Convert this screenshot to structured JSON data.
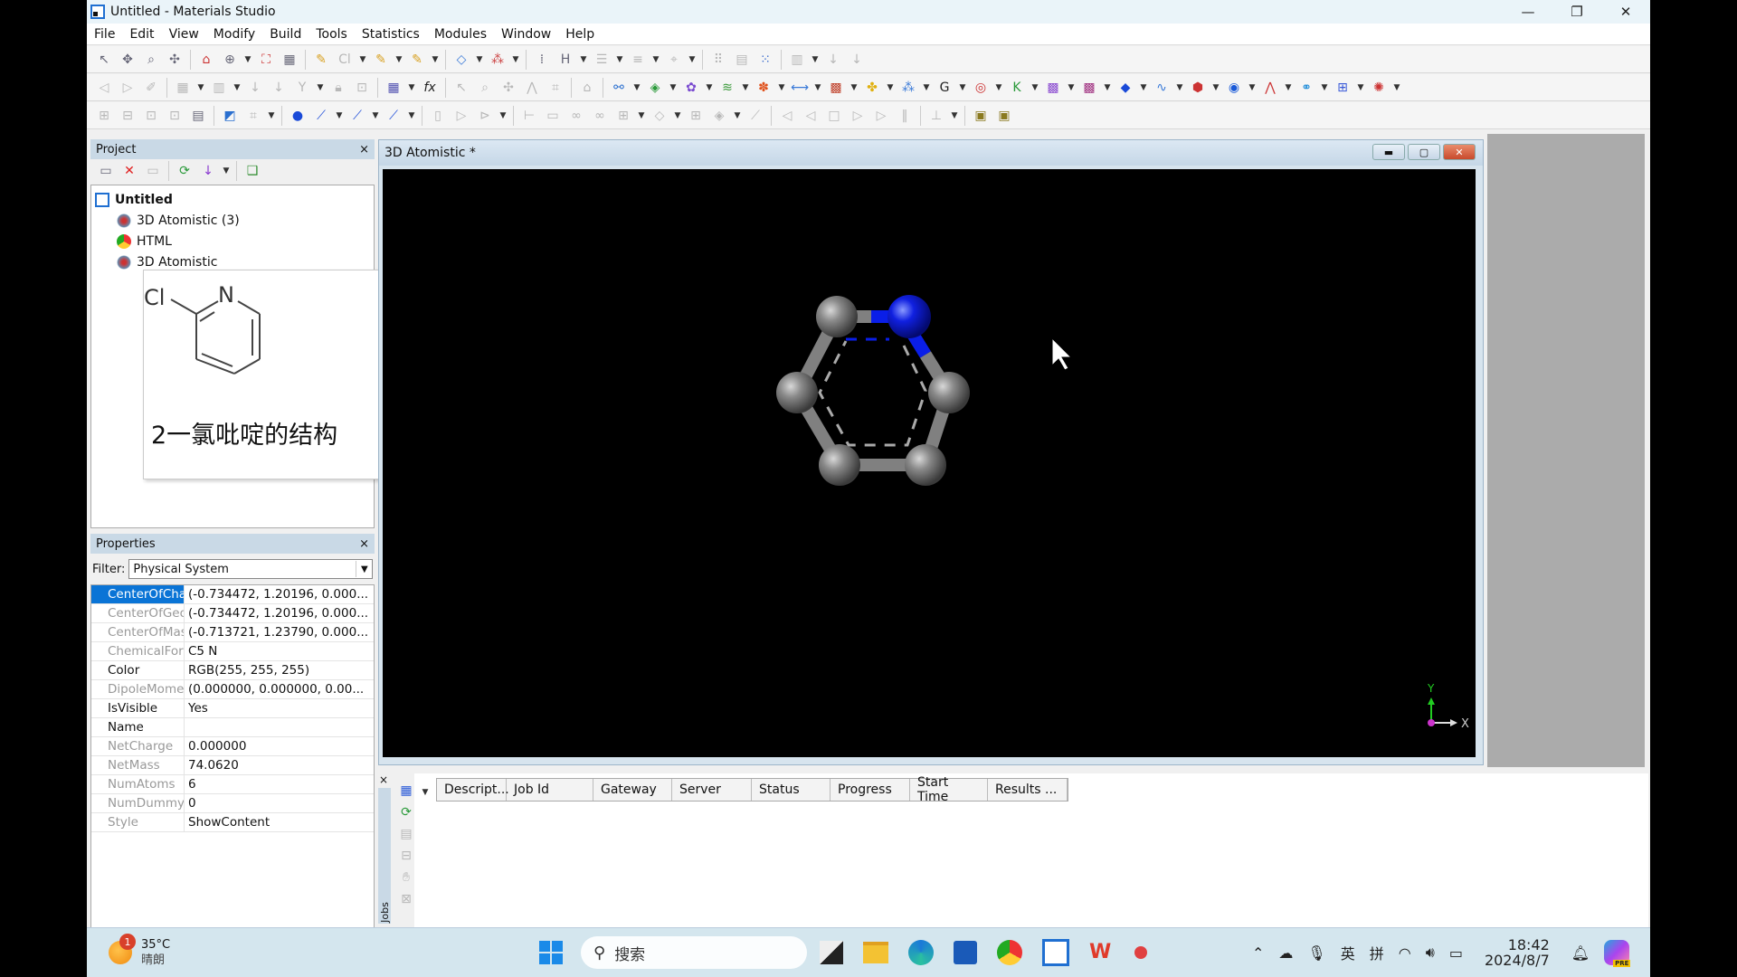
{
  "window": {
    "title": "Untitled - Materials Studio",
    "minimize": "—",
    "restore": "❐",
    "close": "✕"
  },
  "menu": [
    "File",
    "Edit",
    "View",
    "Modify",
    "Build",
    "Tools",
    "Statistics",
    "Modules",
    "Window",
    "Help"
  ],
  "project": {
    "title": "Project",
    "close": "×",
    "tree": {
      "root": "Untitled",
      "children": [
        "3D Atomistic (3)",
        "HTML",
        "3D Atomistic"
      ]
    }
  },
  "popup": {
    "structure_labels": {
      "cl": "Cl",
      "n": "N"
    },
    "caption": "2一氯吡啶的结构"
  },
  "properties": {
    "title": "Properties",
    "close": "×",
    "filter_label": "Filter:",
    "filter_value": "Physical System",
    "rows": [
      {
        "key": "CenterOfCha",
        "value": "(-0.734472, 1.20196, 0.000...",
        "style": "sel"
      },
      {
        "key": "CenterOfGeo",
        "value": "(-0.734472, 1.20196, 0.000...",
        "style": ""
      },
      {
        "key": "CenterOfMas",
        "value": "(-0.713721, 1.23790, 0.000...",
        "style": ""
      },
      {
        "key": "ChemicalForm",
        "value": "C5 N",
        "style": ""
      },
      {
        "key": "Color",
        "value": "RGB(255, 255, 255)",
        "style": "dark"
      },
      {
        "key": "DipoleMome",
        "value": "(0.000000, 0.000000, 0.00...",
        "style": ""
      },
      {
        "key": "IsVisible",
        "value": "Yes",
        "style": "dark"
      },
      {
        "key": "Name",
        "value": "",
        "style": "dark"
      },
      {
        "key": "NetCharge",
        "value": "0.000000",
        "style": ""
      },
      {
        "key": "NetMass",
        "value": "74.0620",
        "style": ""
      },
      {
        "key": "NumAtoms",
        "value": "6",
        "style": ""
      },
      {
        "key": "NumDummy",
        "value": "0",
        "style": ""
      },
      {
        "key": "Style",
        "value": "ShowContent",
        "style": ""
      }
    ]
  },
  "viewer": {
    "title": "3D Atomistic *",
    "axis": {
      "x": "X",
      "y": "Y"
    },
    "colors": {
      "carbon": "#808080",
      "nitrogen": "#0a1ee8"
    }
  },
  "jobs": {
    "tab_label": "Jobs",
    "close": "×",
    "columns": [
      "Descript...",
      "Job Id",
      "Gateway",
      "Server",
      "Status",
      "Progress",
      "Start Time",
      "Results ..."
    ]
  },
  "taskbar": {
    "weather_temp": "35°C",
    "weather_desc": "晴朗",
    "weather_badge": "1",
    "search_placeholder": "搜索",
    "tray": {
      "ime1": "英",
      "ime2": "拼",
      "time": "18:42",
      "date": "2024/8/7",
      "copilot_badge": "PRE"
    }
  }
}
